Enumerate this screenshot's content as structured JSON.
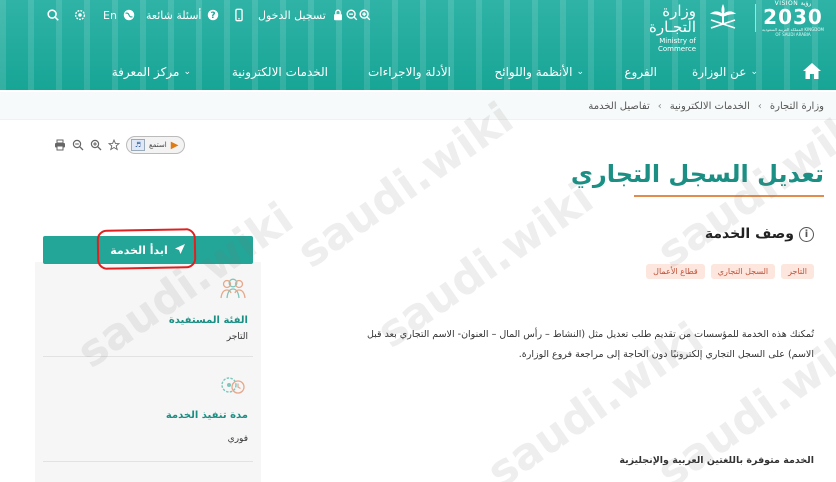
{
  "topbar": {
    "language": "En",
    "faq": "أسئلة شائعة",
    "login": "تسجيل الدخول"
  },
  "logo": {
    "ministry_ar": "وزارة التجـارة",
    "ministry_en": "Ministry of Commerce",
    "vision_small": "VISION رؤية",
    "vision_year": "2030",
    "vision_kingdom": "المملكة العربية السعودية KINGDOM OF SAUDI ARABIA"
  },
  "nav": {
    "items": [
      {
        "label": "عن الوزارة",
        "has_caret": true
      },
      {
        "label": "الفروع",
        "has_caret": false
      },
      {
        "label": "الأنظمة واللوائح",
        "has_caret": true
      },
      {
        "label": "الأدلة والاجراءات",
        "has_caret": false
      },
      {
        "label": "الخدمات الالكترونية",
        "has_caret": false
      },
      {
        "label": "مركز المعرفة",
        "has_caret": true
      }
    ]
  },
  "breadcrumb": [
    "وزارة التجارة",
    "الخدمات الالكترونية",
    "تفاصيل الخدمة"
  ],
  "player": {
    "label": "استمع"
  },
  "page": {
    "title": "تعديل السجل التجاري",
    "description_heading": "وصف الخدمة",
    "tags": [
      "التاجر",
      "السجل التجاري",
      "قطاع الأعمال"
    ],
    "description": "تُمكنك هذه الخدمة للمؤسسات  من تقديم طلب تعديل مثل (النشاط – رأس المال – العنوان- الاسم التجاري بعد قبل الاسم)  على السجل التجاري إلكترونيًا دون الحاجة إلى مراجعة فروع الوزارة.",
    "language_note": "الخدمة متوفرة باللغتين العربية والإنجليزية"
  },
  "sidebar": {
    "start_button": "ابدأ الخدمة",
    "beneficiary_label": "الفئة المستفيدة",
    "beneficiary_value": "التاجر",
    "duration_label": "مدة تنفيذ الخدمة",
    "duration_value": "فوري"
  },
  "watermark": "saudi.wiki",
  "colors": {
    "primary": "#23a597",
    "title": "#1b8f84",
    "accent_underline": "#e38b4a",
    "tag_bg": "#fde6dd",
    "tag_text": "#c0533a",
    "annotation": "#e02020"
  }
}
